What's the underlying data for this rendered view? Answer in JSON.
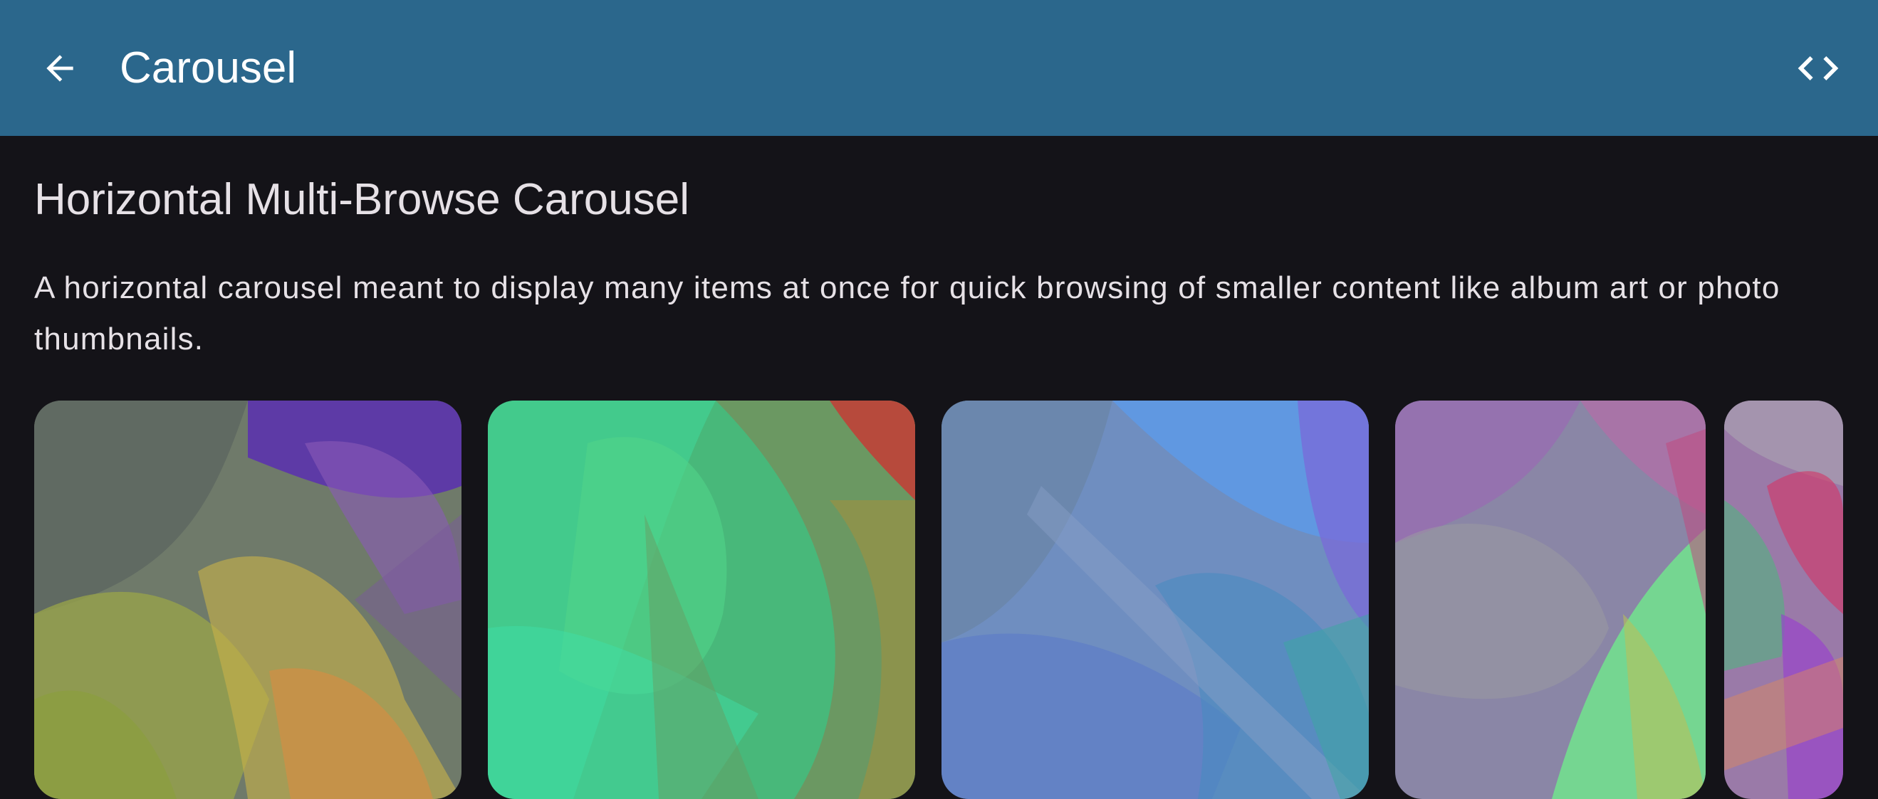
{
  "app_bar": {
    "title": "Carousel",
    "back_icon": "arrow-back-icon",
    "code_icon": "code-icon",
    "background": "#2b678c"
  },
  "section": {
    "title": "Horizontal Multi-Browse Carousel",
    "description": "A horizontal carousel meant to display many items at once for quick browsing of smaller content like album art or photo thumbnails."
  },
  "carousel": {
    "items": [
      {
        "name": "carousel-item-1",
        "base": "#7d8a74",
        "colors": [
          "#5a3aa8",
          "#a4b83a",
          "#d89a3a",
          "#6a5d6a"
        ]
      },
      {
        "name": "carousel-item-2",
        "base": "#4cc48a",
        "colors": [
          "#3fe0a8",
          "#8a8a50",
          "#d03a3a",
          "#5ab878"
        ]
      },
      {
        "name": "carousel-item-3",
        "base": "#6e8cc8",
        "colors": [
          "#4a9cf0",
          "#7a6ad0",
          "#3a9ab0",
          "#8aa0d8"
        ]
      },
      {
        "name": "carousel-item-4",
        "base": "#8a8aa8",
        "colors": [
          "#9a6ab8",
          "#6ef08a",
          "#b8a07a",
          "#c86aa0"
        ]
      },
      {
        "name": "carousel-item-5",
        "base": "#a06aa0",
        "colors": [
          "#d03a6a",
          "#4ab87a",
          "#9a3ad0",
          "#e08a5a"
        ]
      }
    ]
  }
}
